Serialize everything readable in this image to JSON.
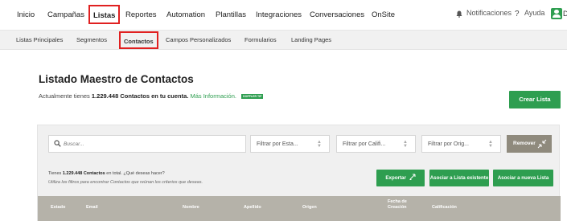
{
  "topnav": {
    "items": [
      "Inicio",
      "Campañas",
      "Listas",
      "Reportes",
      "Automation",
      "Plantillas",
      "Integraciones",
      "Conversaciones",
      "OnSite"
    ],
    "active": "Listas",
    "notifications": "Notificaciones",
    "help": "Ayuda",
    "help_mark": "?",
    "avatar_letter": "D"
  },
  "subnav": {
    "items": [
      "Listas Principales",
      "Segmentos",
      "Contactos",
      "Campos Personalizados",
      "Formularios",
      "Landing Pages"
    ],
    "active": "Contactos"
  },
  "header": {
    "title": "Listado Maestro de Contactos",
    "subtitle_pre": "Actualmente tienes",
    "subtitle_count": "1.229.448 Contactos en tu cuenta.",
    "more_info": "Más Información.",
    "tip_badge": "DOPPLER TIP",
    "create_button": "Crear Lista"
  },
  "filters": {
    "search_placeholder": "Buscar...",
    "selects": [
      "Filtrar por Esta...",
      "Filtrar por Califi...",
      "Filtrar por Orig..."
    ],
    "remove_button": "Remover"
  },
  "info": {
    "line1_pre": "Tienes",
    "line1_count": "1.229.448 Contactos",
    "line1_post": "en total. ¿Qué deseas hacer?",
    "line2": "Utiliza los filtros para encontrar Contactos que reúnan los criterios que deseas."
  },
  "actions": {
    "export": "Exportar",
    "assign_existing": "Asociar a Lista existente",
    "assign_new": "Asociar a nueva Lista"
  },
  "table": {
    "columns": [
      "Estado",
      "Email",
      "Nombre",
      "Apellido",
      "Origen",
      "Fecha de Creación",
      "Calificación"
    ]
  },
  "colors": {
    "brand_green": "#2e9e50",
    "highlight_red": "#e02020",
    "table_header": "#b5b2a9"
  }
}
